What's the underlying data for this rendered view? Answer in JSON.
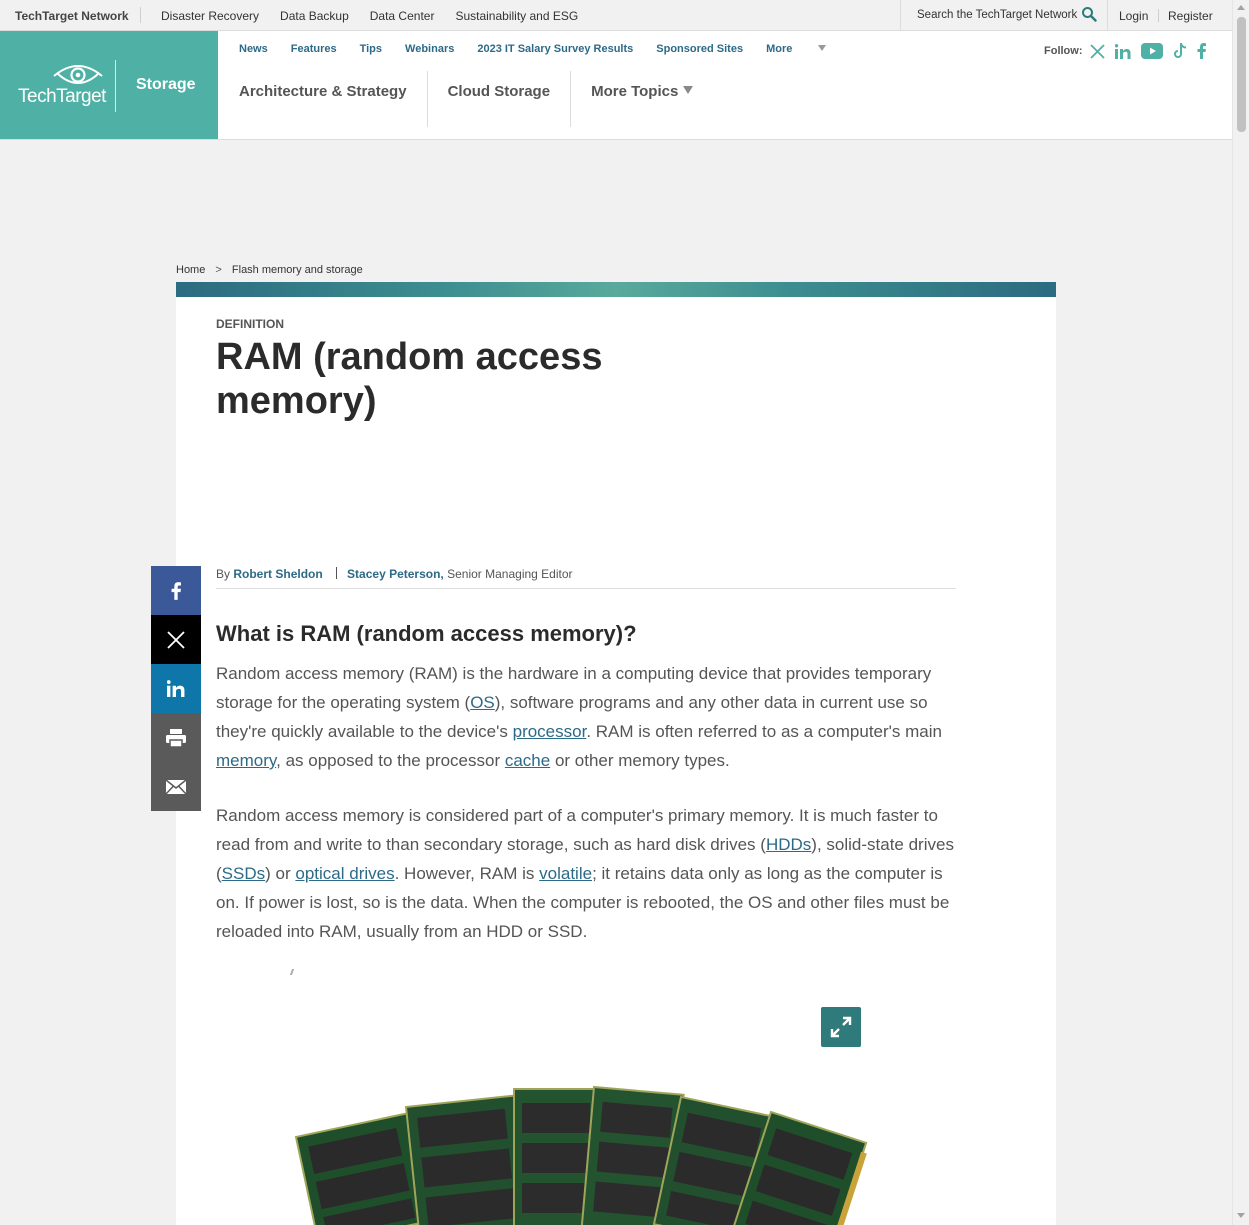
{
  "network_bar": {
    "network_name": "TechTarget Network",
    "links": [
      "Disaster Recovery",
      "Data Backup",
      "Data Center",
      "Sustainability and ESG"
    ],
    "search_placeholder": "Search the TechTarget Network",
    "login": "Login",
    "register": "Register"
  },
  "brand": {
    "logo_text": "TechTarget",
    "site_name": "Storage",
    "color": "#4fb1a6"
  },
  "subnav": {
    "items": [
      "News",
      "Features",
      "Tips",
      "Webinars",
      "2023 IT Salary Survey Results",
      "Sponsored Sites",
      "More"
    ]
  },
  "topics": [
    "Architecture & Strategy",
    "Cloud Storage",
    "More Topics"
  ],
  "follow": {
    "label": "Follow:",
    "icons": [
      "x-icon",
      "linkedin-icon",
      "youtube-icon",
      "tiktok-icon",
      "facebook-icon"
    ]
  },
  "breadcrumb": {
    "home": "Home",
    "separator": ">",
    "current": "Flash memory and storage"
  },
  "article": {
    "eyebrow": "DEFINITION",
    "title": "RAM (random access memory)",
    "byline": {
      "by": "By",
      "author1": "Robert Sheldon",
      "author2": "Stacey Peterson,",
      "author2_role": "Senior Managing Editor"
    },
    "heading": "What is RAM (random access memory)?",
    "p1": {
      "t1": "Random access memory (RAM) is the hardware in a computing device that provides temporary storage for the operating system (",
      "l1": "OS",
      "t2": "), software programs and any other data in current use so they're quickly available to the device's ",
      "l2": "processor",
      "t3": ". RAM is often referred to as a computer's main ",
      "l3": "memory",
      "t4": ", as opposed to the processor ",
      "l4": "cache",
      "t5": " or other memory types."
    },
    "p2": {
      "t1": "Random access memory is considered part of a computer's primary memory. It is much faster to read from and write to than secondary storage, such as hard disk drives (",
      "l1": "HDDs",
      "t2": "), solid-state drives (",
      "l2": "SSDs",
      "t3": ") or ",
      "l3": "optical drives",
      "t4": ". However, RAM is ",
      "l4": "volatile",
      "t5": "; it retains data only as long as the computer is on. If power is lost, so is the data. When the computer is rebooted, the OS and other files must be reloaded into RAM, usually from an HDD or SSD."
    }
  },
  "share_icons": [
    "facebook-icon",
    "x-icon",
    "linkedin-icon",
    "print-icon",
    "email-icon"
  ],
  "colors": {
    "link": "#2d6a87",
    "accent_teal": "#2f7a7b",
    "facebook": "#3b5998",
    "linkedin": "#0e76a8"
  }
}
